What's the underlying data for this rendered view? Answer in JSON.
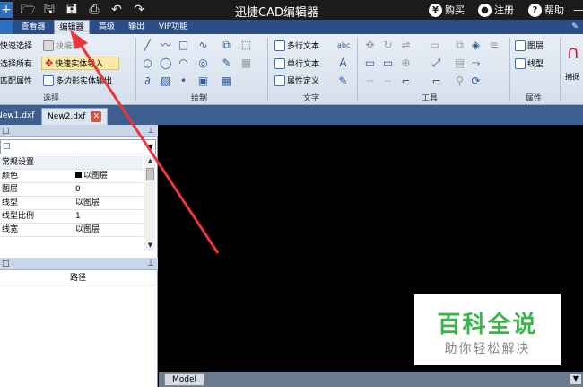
{
  "title_bar": {
    "app_title": "迅捷CAD编辑器",
    "buy": "购买",
    "register": "注册",
    "help": "帮助",
    "buy_icon": "¥",
    "register_icon": "person-icon",
    "help_icon": "?"
  },
  "menu": {
    "tabs": [
      {
        "label": "查看器"
      },
      {
        "label": "编辑器"
      },
      {
        "label": "高级"
      },
      {
        "label": "输出"
      },
      {
        "label": "VIP功能"
      }
    ],
    "active": "编辑器"
  },
  "ribbon": {
    "select_group": {
      "label": "选择",
      "items": [
        "快速选择",
        "选择所有",
        "匹配属性"
      ],
      "block_edit": "块编辑",
      "fast_entity_import": "快速实体导入",
      "polygon_entity": "多边形实体输出"
    },
    "draw_group": {
      "label": "绘制"
    },
    "text_group": {
      "label": "文字",
      "items": [
        "多行文本",
        "单行文本",
        "属性定义"
      ]
    },
    "tools_group": {
      "label": "工具"
    },
    "props_group": {
      "label": "属性",
      "layer": "图层",
      "linetype": "线型"
    },
    "capture": "捕捉"
  },
  "doc_tabs": [
    {
      "label": "New1.dxf"
    },
    {
      "label": "New2.dxf"
    }
  ],
  "properties_panel": {
    "rows": [
      {
        "key": "常规设置",
        "value": "",
        "category": true
      },
      {
        "key": "颜色",
        "value": "以图层"
      },
      {
        "key": "图层",
        "value": "0"
      },
      {
        "key": "线型",
        "value": "以图层"
      },
      {
        "key": "线型比例",
        "value": "1"
      },
      {
        "key": "线宽",
        "value": "以图层"
      }
    ],
    "color_swatch": "#000000"
  },
  "file_panel": {
    "path_header": "路径"
  },
  "model_tab": "Model",
  "watermark": {
    "big": "百科全说",
    "small": "助你轻松解决"
  },
  "colors": {
    "menubar": "#2b4f85",
    "titlebar": "#1b1b1b",
    "arrow": "#e8373a",
    "watermark_green": "#39b54a"
  }
}
